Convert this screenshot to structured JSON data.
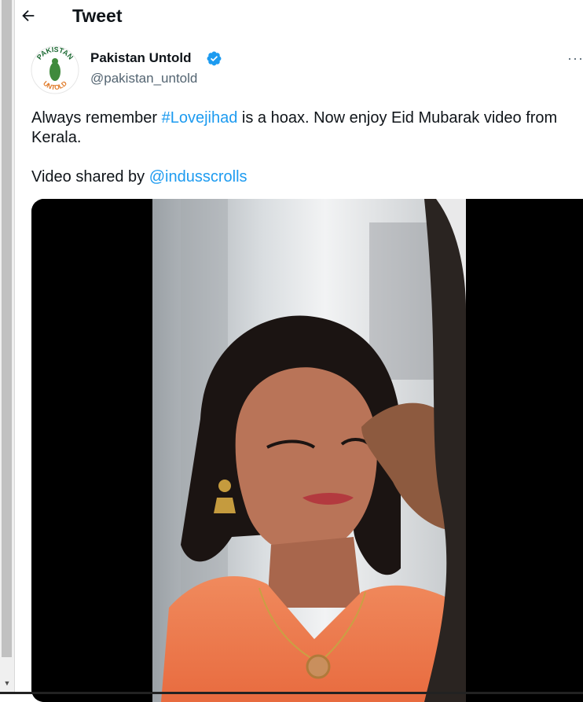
{
  "header": {
    "title": "Tweet",
    "back_icon": "arrow-left-icon"
  },
  "author": {
    "name": "Pakistan Untold",
    "handle": "@pakistan_untold",
    "verified_icon": "verified-badge-icon",
    "avatar_text_top": "PAKISTAN",
    "avatar_text_bottom": "UNTOLD"
  },
  "tweet": {
    "line1_prefix": "Always remember ",
    "hashtag": "#Lovejihad",
    "line1_suffix": " is a hoax. Now enjoy Eid Mubarak video from Kerala.",
    "line2_prefix": "Video shared by ",
    "mention": "@indusscrolls"
  },
  "more_label": "···",
  "colors": {
    "link": "#1d9bf0",
    "verified": "#1d9bf0",
    "text": "#0f1419",
    "muted": "#536471"
  }
}
